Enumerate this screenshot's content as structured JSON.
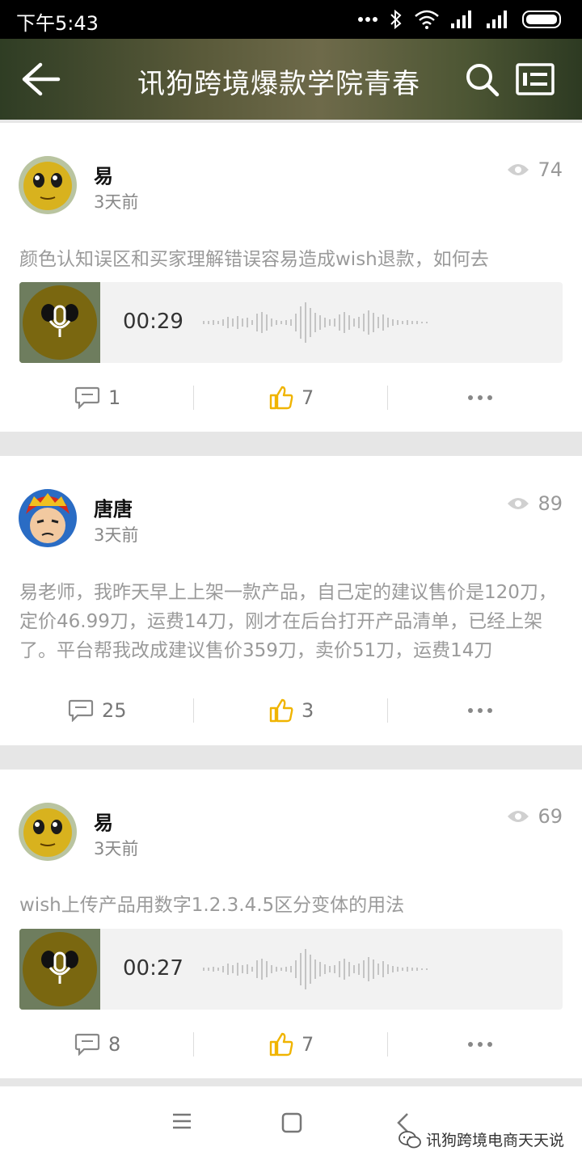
{
  "status_bar": {
    "time": "下午5:43"
  },
  "header": {
    "title": "讯狗跨境爆款学院青春"
  },
  "posts": [
    {
      "user": "易",
      "time": "3天前",
      "views": "74",
      "text": "颜色认知误区和买家理解错误容易造成wish退款，如何去",
      "audio_duration": "00:29",
      "comments": "1",
      "likes": "7"
    },
    {
      "user": "唐唐",
      "time": "3天前",
      "views": "89",
      "text": "易老师，我昨天早上上架一款产品，自己定的建议售价是120刀，定价46.99刀，运费14刀，刚才在后台打开产品清单，已经上架了。平台帮我改成建议售价359刀，卖价51刀，运费14刀",
      "comments": "25",
      "likes": "3"
    },
    {
      "user": "易",
      "time": "3天前",
      "views": "69",
      "text": "wish上传产品用数字1.2.3.4.5区分变体的用法",
      "audio_duration": "00:27",
      "comments": "8",
      "likes": "7"
    }
  ],
  "watermark": {
    "text": "讯狗跨境电商天天说"
  },
  "colors": {
    "like_icon": "#f0b400",
    "header_overlay": "#4a5533"
  }
}
